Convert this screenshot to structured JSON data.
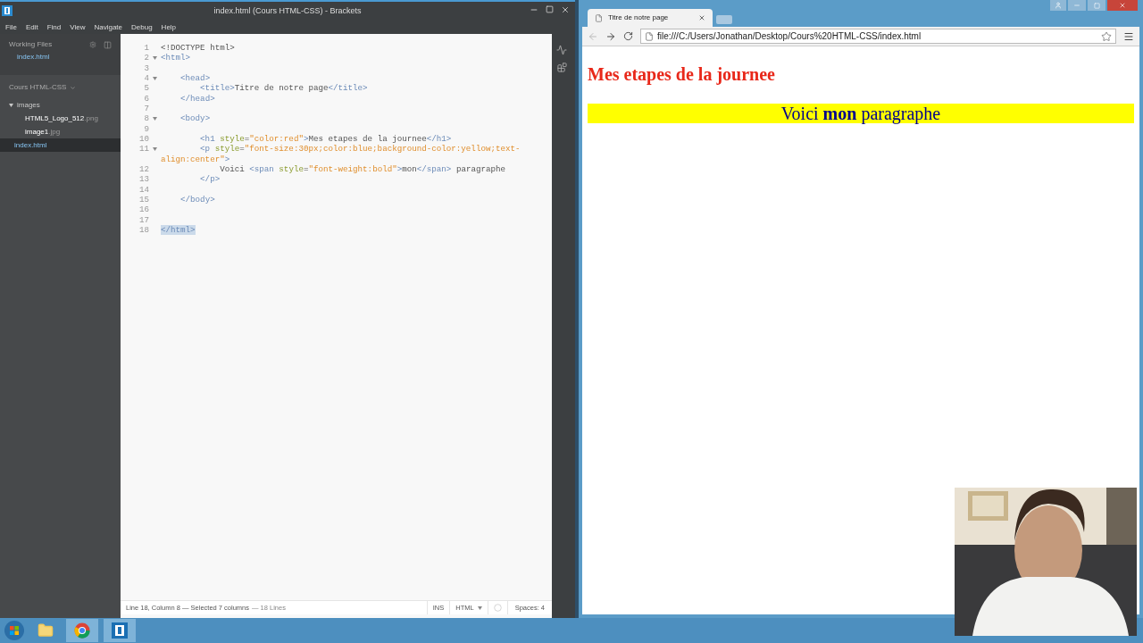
{
  "editor_window": {
    "title": "index.html (Cours HTML-CSS) - Brackets",
    "menu": [
      "File",
      "Edit",
      "Find",
      "View",
      "Navigate",
      "Debug",
      "Help"
    ]
  },
  "sidebar": {
    "working_files_label": "Working Files",
    "working_files": [
      {
        "name": "index.html",
        "selected": false
      }
    ],
    "project": "Cours HTML-CSS",
    "tree": [
      {
        "name": "images",
        "kind": "folder",
        "expanded": true,
        "selected": false,
        "children": [
          {
            "name": "HTML5_Logo_512",
            "ext": ".png",
            "selected": false
          },
          {
            "name": "image1",
            "ext": ".jpg",
            "selected": false
          }
        ]
      },
      {
        "name": "index.html",
        "kind": "file",
        "selected": true
      }
    ]
  },
  "code": {
    "lines": [
      {
        "number": "1",
        "foldable": false,
        "selected": false,
        "text": "<!DOCTYPE html>"
      },
      {
        "number": "2",
        "foldable": true,
        "selected": false,
        "text": "<html>"
      },
      {
        "number": "3",
        "foldable": false,
        "selected": false
      },
      {
        "number": "4",
        "foldable": true,
        "selected": false,
        "text": "    <head>"
      },
      {
        "number": "5",
        "foldable": false,
        "selected": false,
        "text": "        <title>Titre de notre page</title>"
      },
      {
        "number": "6",
        "foldable": false,
        "selected": false,
        "text": "    </head>"
      },
      {
        "number": "7",
        "foldable": false,
        "selected": false
      },
      {
        "number": "8",
        "foldable": true,
        "selected": false,
        "text": "    <body>"
      },
      {
        "number": "9",
        "foldable": false,
        "selected": false
      },
      {
        "number": "10",
        "foldable": false,
        "selected": false,
        "text": "        <h1 style=\"color:red\">Mes etapes de la journee</h1>"
      },
      {
        "number": "11",
        "foldable": true,
        "selected": false,
        "text": "        <p style=\"font-size:30px;color:blue;background-color:yellow;text-align:center\">"
      },
      {
        "number": "12",
        "foldable": false,
        "selected": false,
        "text": "            Voici <span style=\"font-weight:bold\">mon</span> paragraphe"
      },
      {
        "number": "13",
        "foldable": false,
        "selected": false,
        "text": "        </p>"
      },
      {
        "number": "14",
        "foldable": false,
        "selected": false
      },
      {
        "number": "15",
        "foldable": false,
        "selected": false,
        "text": "    </body>"
      },
      {
        "number": "16",
        "foldable": false,
        "selected": false
      },
      {
        "number": "17",
        "foldable": false,
        "selected": false
      },
      {
        "number": "18",
        "foldable": false,
        "selected": true,
        "text": "</html>"
      }
    ]
  },
  "status_bar": {
    "position": "Line 18, Column 8 — Selected 7 columns",
    "lines": "— 18 Lines",
    "mode": "INS",
    "language": "HTML",
    "spaces": "Spaces: 4"
  },
  "browser": {
    "tab": "Titre de notre page",
    "url": "file:///C:/Users/Jonathan/Desktop/Cours%20HTML-CSS/index.html",
    "heading": "Mes etapes de la journee",
    "paragraph": "Voici **mon** paragraphe"
  }
}
